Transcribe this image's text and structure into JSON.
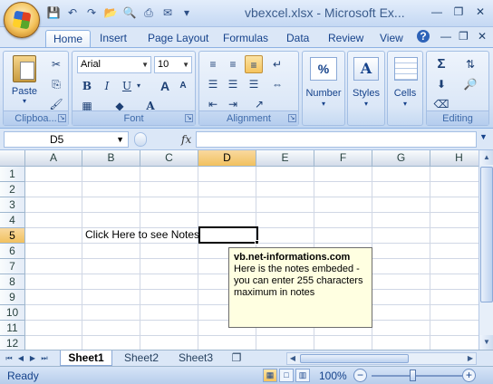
{
  "window": {
    "title": "vbexcel.xlsx - Microsoft Ex..."
  },
  "quick_access": {
    "icons": [
      "save-icon",
      "undo-icon",
      "redo-icon",
      "open-folder-icon",
      "print-preview-icon",
      "quick-print-icon",
      "mail-icon"
    ]
  },
  "ribbon_tabs": [
    "Home",
    "Insert",
    "Page Layout",
    "Formulas",
    "Data",
    "Review",
    "View"
  ],
  "active_tab": "Home",
  "ribbon": {
    "clipboard": {
      "label": "Clipboa...",
      "paste_label": "Paste"
    },
    "font": {
      "label": "Font",
      "font_name": "Arial",
      "font_size": "10",
      "bold": "B",
      "italic": "I",
      "underline": "U",
      "grow": "A",
      "shrink": "A",
      "font_color_icon": "A"
    },
    "alignment": {
      "label": "Alignment"
    },
    "number": {
      "label": "Number",
      "icon": "%"
    },
    "styles": {
      "label": "Styles"
    },
    "cells": {
      "label": "Cells"
    },
    "editing": {
      "label": "Editing",
      "sum": "Σ"
    }
  },
  "formula_bar": {
    "name_box": "D5",
    "fx": "fx",
    "formula": ""
  },
  "grid": {
    "columns": [
      "A",
      "B",
      "C",
      "D",
      "E",
      "F",
      "G",
      "H"
    ],
    "selected_column": "D",
    "rows": [
      "1",
      "2",
      "3",
      "4",
      "5",
      "6",
      "7",
      "8",
      "9",
      "10",
      "11",
      "12"
    ],
    "selected_row": "5",
    "cell_text": "Click  Here to see Notes"
  },
  "comment": {
    "author": "vb.net-informations.com",
    "text": "Here is the notes embeded - you can enter 255 characters maximum in notes"
  },
  "sheets": [
    "Sheet1",
    "Sheet2",
    "Sheet3"
  ],
  "active_sheet": "Sheet1",
  "status": {
    "text": "Ready",
    "zoom": "100%",
    "zoom_minus": "−",
    "zoom_plus": "+"
  },
  "colors": {
    "ribbon_bg": "#dbe7f7",
    "selected_header": "#f1c15f",
    "comment_bg": "#ffffe1",
    "text_blue": "#15428b"
  }
}
